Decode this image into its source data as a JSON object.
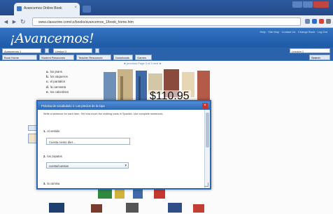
{
  "browser": {
    "tab_title": "Avancemos Online Book",
    "tab_close": "×",
    "address": "www.classzone.com/cz/books/avancemos_1/book_home.htm"
  },
  "site": {
    "logo": "¡Avancemos!",
    "header_links": "Help · Site Map · Contact Us · Change Book · Log Out",
    "selectors": [
      "Avancemos 1",
      "Unidad 3",
      "Lección 1"
    ],
    "nav_tabs": [
      "Book Home",
      "Student Resources",
      "Teacher Resources",
      "Downloads",
      "Games"
    ],
    "search_label": "Search"
  },
  "content": {
    "pager": "◄ previous  Page 3 of 3  next ►",
    "answers": [
      {
        "letter": "a.",
        "text": "los jeans"
      },
      {
        "letter": "b.",
        "text": "los vaqueros"
      },
      {
        "letter": "c.",
        "text": "el pantalón"
      },
      {
        "letter": "d.",
        "text": "la camiseta"
      },
      {
        "letter": "e.",
        "text": "los calcetines"
      }
    ],
    "price": "$110.95"
  },
  "modal": {
    "title": "Práctica de vocabulario 1: Los precios de la ropa",
    "close": "×",
    "instructions": "Write a sentence for each item. Tell how much the clothing costs in Spanish. Use complete sentences.",
    "q1_label_num": "1.",
    "q1_label": "el vestido",
    "q1_value": "Cuesta ciento diez...",
    "q2_label_num": "2.",
    "q2_label": "los zapatos",
    "q2_select": "cuesta/cuestan",
    "q3_label_num": "3.",
    "q3_label": "la camisa"
  }
}
